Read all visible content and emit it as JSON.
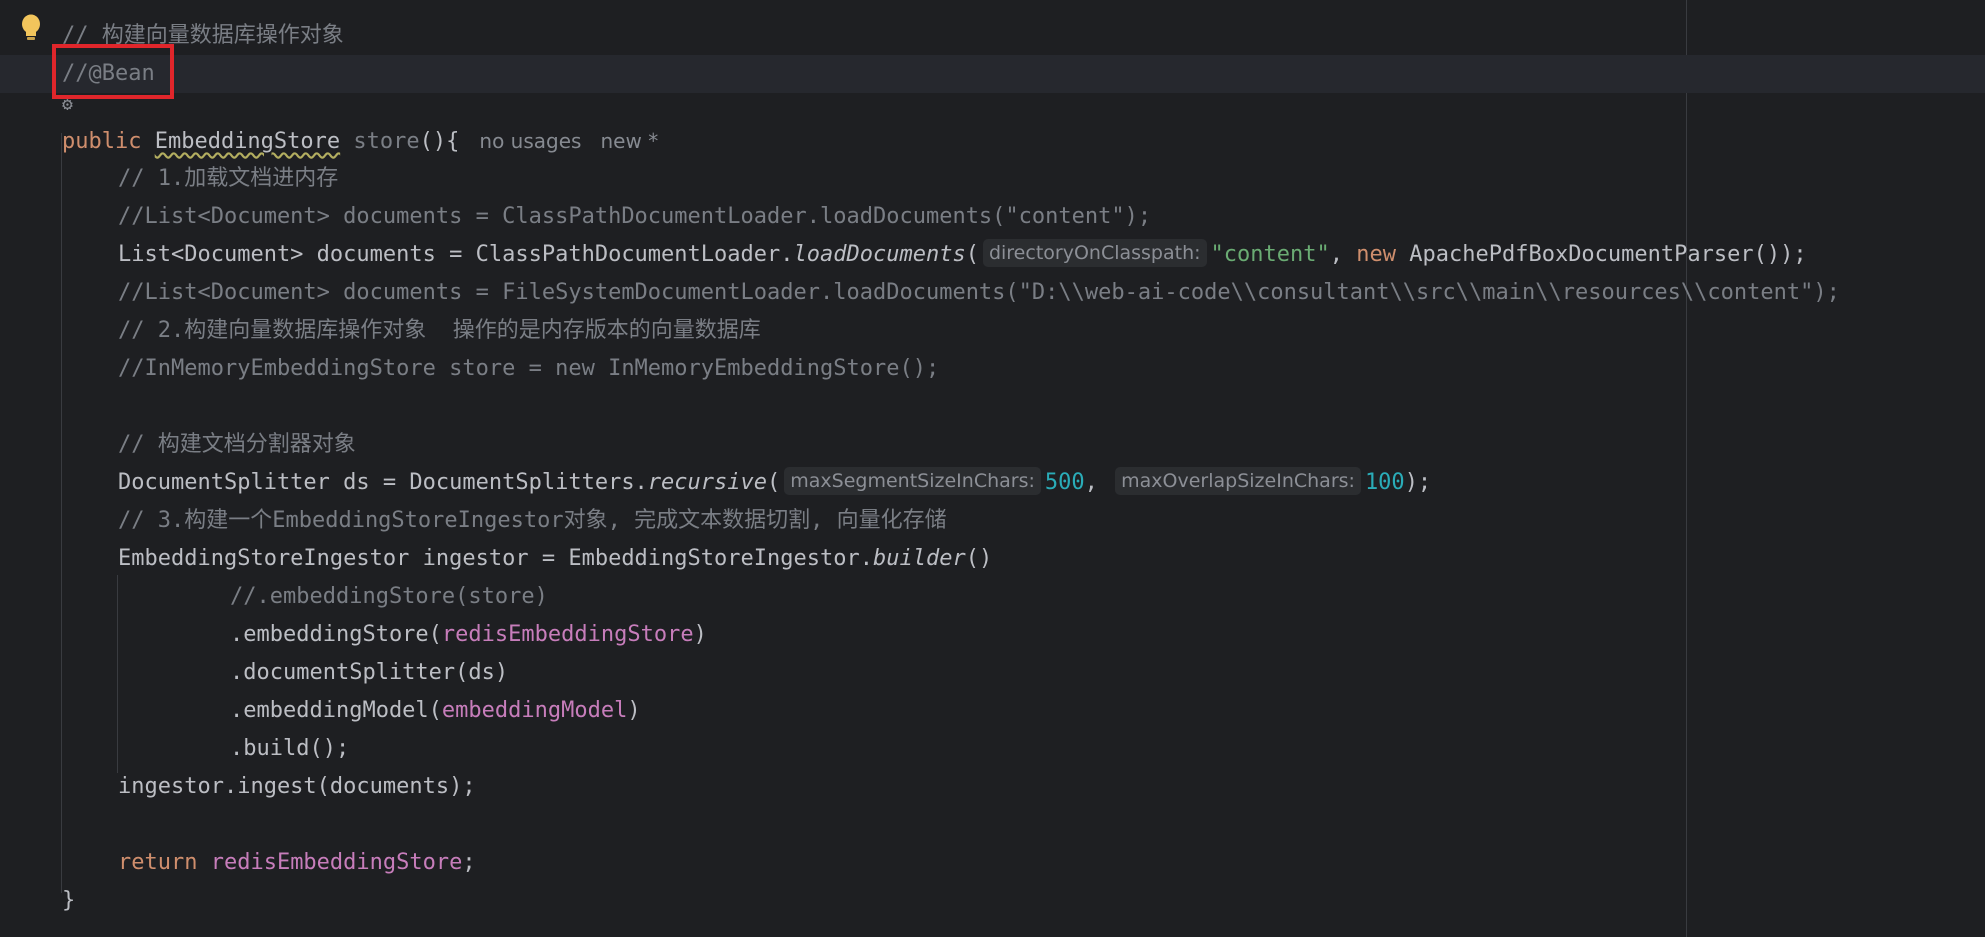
{
  "editor": {
    "lines": [
      [
        {
          "t": "// 构建向量数据库操作对象",
          "c": "c-comment"
        }
      ],
      [
        {
          "t": "//@Bean",
          "c": "c-comment"
        }
      ],
      [],
      [
        {
          "t": "public ",
          "c": "c-keyword"
        },
        {
          "t": "EmbeddingStore",
          "c": "c-plain c-underline"
        },
        {
          "t": " ",
          "c": "c-plain"
        },
        {
          "t": "store",
          "c": "c-comment"
        },
        {
          "t": "(){",
          "c": "c-plain"
        }
      ],
      [
        {
          "t": "// 1.加载文档进内存",
          "c": "c-comment"
        }
      ],
      [
        {
          "t": "//List<Document> documents = ClassPathDocumentLoader.loadDocuments(\"content\");",
          "c": "c-comment"
        }
      ],
      [
        {
          "t": "List<Document> documents = ClassPathDocumentLoader.",
          "c": "c-plain"
        },
        {
          "t": "loadDocuments",
          "c": "c-plain c-italic"
        },
        {
          "t": "(",
          "c": "c-plain"
        },
        {
          "hint": "directoryOnClasspath:"
        },
        {
          "t": "\"content\"",
          "c": "c-string"
        },
        {
          "t": ", ",
          "c": "c-plain"
        },
        {
          "t": "new ",
          "c": "c-keyword"
        },
        {
          "t": "ApachePdfBoxDocumentParser());",
          "c": "c-plain"
        }
      ],
      [
        {
          "t": "//List<Document> documents = FileSystemDocumentLoader.loadDocuments(\"D:\\\\web-ai-code\\\\consultant\\\\src\\\\main\\\\resources\\\\content\");",
          "c": "c-comment"
        }
      ],
      [
        {
          "t": "// 2.构建向量数据库操作对象  操作的是内存版本的向量数据库",
          "c": "c-comment"
        }
      ],
      [
        {
          "t": "//InMemoryEmbeddingStore store = new InMemoryEmbeddingStore();",
          "c": "c-comment"
        }
      ],
      [],
      [
        {
          "t": "// 构建文档分割器对象",
          "c": "c-comment"
        }
      ],
      [
        {
          "t": "DocumentSplitter ds = DocumentSplitters.",
          "c": "c-plain"
        },
        {
          "t": "recursive",
          "c": "c-plain c-italic"
        },
        {
          "t": "(",
          "c": "c-plain"
        },
        {
          "hint": "maxSegmentSizeInChars:"
        },
        {
          "t": "500",
          "c": "c-number"
        },
        {
          "t": ", ",
          "c": "c-plain"
        },
        {
          "hint": "maxOverlapSizeInChars:"
        },
        {
          "t": "100",
          "c": "c-number"
        },
        {
          "t": ");",
          "c": "c-plain"
        }
      ],
      [
        {
          "t": "// 3.构建一个EmbeddingStoreIngestor对象, 完成文本数据切割, 向量化存储",
          "c": "c-comment"
        }
      ],
      [
        {
          "t": "EmbeddingStoreIngestor ingestor = EmbeddingStoreIngestor.",
          "c": "c-plain"
        },
        {
          "t": "builder",
          "c": "c-plain c-italic"
        },
        {
          "t": "()",
          "c": "c-plain"
        }
      ],
      [
        {
          "t": "//.embeddingStore(store)",
          "c": "c-comment"
        }
      ],
      [
        {
          "t": ".embeddingStore(",
          "c": "c-plain"
        },
        {
          "t": "redisEmbeddingStore",
          "c": "c-field"
        },
        {
          "t": ")",
          "c": "c-plain"
        }
      ],
      [
        {
          "t": ".documentSplitter(ds)",
          "c": "c-plain"
        }
      ],
      [
        {
          "t": ".embeddingModel(",
          "c": "c-plain"
        },
        {
          "t": "embeddingModel",
          "c": "c-field"
        },
        {
          "t": ")",
          "c": "c-plain"
        }
      ],
      [
        {
          "t": ".build();",
          "c": "c-plain"
        }
      ],
      [
        {
          "t": "ingestor.ingest(documents);",
          "c": "c-plain"
        }
      ],
      [],
      [
        {
          "t": "return ",
          "c": "c-keyword"
        },
        {
          "t": "redisEmbeddingStore",
          "c": "c-field"
        },
        {
          "t": ";",
          "c": "c-plain"
        }
      ],
      [
        {
          "t": "}",
          "c": "c-plain"
        }
      ]
    ],
    "usage_hint": "no usages   new *"
  },
  "colors": {
    "background": "#1e1f22",
    "current_line": "#26282e",
    "highlight_box": "#e0262b",
    "comment": "#7a7e85",
    "keyword": "#cf8e6d",
    "string": "#6aab73",
    "number": "#2aacb8",
    "field": "#c77dbb"
  },
  "icons": {
    "gutter": "lightbulb-icon",
    "inlay": "gear-icon"
  }
}
